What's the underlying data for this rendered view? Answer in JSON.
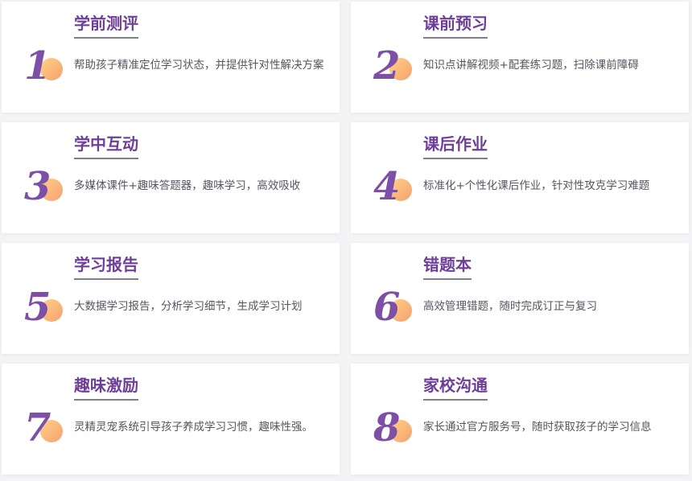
{
  "cards": [
    {
      "num": "1",
      "title": "学前测评",
      "desc": "帮助孩子精准定位学习状态，并提供针对性解决方案"
    },
    {
      "num": "2",
      "title": "课前预习",
      "desc": "知识点讲解视频+配套练习题，扫除课前障碍"
    },
    {
      "num": "3",
      "title": "学中互动",
      "desc": "多媒体课件+趣味答题器，趣味学习，高效吸收"
    },
    {
      "num": "4",
      "title": "课后作业",
      "desc": "标准化+个性化课后作业，针对性攻克学习难题"
    },
    {
      "num": "5",
      "title": "学习报告",
      "desc": "大数据学习报告，分析学习细节，生成学习计划"
    },
    {
      "num": "6",
      "title": "错题本",
      "desc": "高效管理错题，随时完成订正与复习"
    },
    {
      "num": "7",
      "title": "趣味激励",
      "desc": "灵精灵宠系统引导孩子养成学习习惯，趣味性强。"
    },
    {
      "num": "8",
      "title": "家校沟通",
      "desc": "家长通过官方服务号，随时获取孩子的学习信息"
    }
  ],
  "colors": {
    "accent": "#7e4fa6",
    "title": "#6e3e98",
    "dot_start": "#ffd28a",
    "dot_end": "#f6a06c"
  }
}
